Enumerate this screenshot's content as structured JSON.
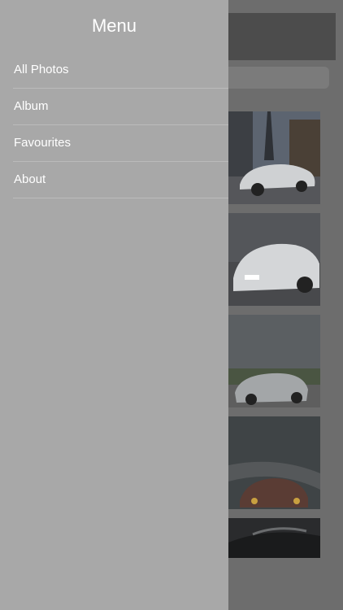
{
  "menu": {
    "title": "Menu",
    "items": [
      {
        "label": "All Photos"
      },
      {
        "label": "Album"
      },
      {
        "label": "Favourites"
      },
      {
        "label": "About"
      }
    ]
  },
  "colors": {
    "menu_background": "#a8a8a8",
    "overlay_background": "#6d6d6d",
    "menu_text": "#ffffff",
    "separator": "#bbbbbb"
  },
  "gallery": {
    "photos": [
      {
        "subject": "white-audi-tt-city-street"
      },
      {
        "subject": "white-audi-tt-front-view"
      },
      {
        "subject": "silver-audi-tt-roadster-rear"
      },
      {
        "subject": "audi-race-car-track"
      },
      {
        "subject": "black-car-detail"
      }
    ]
  }
}
